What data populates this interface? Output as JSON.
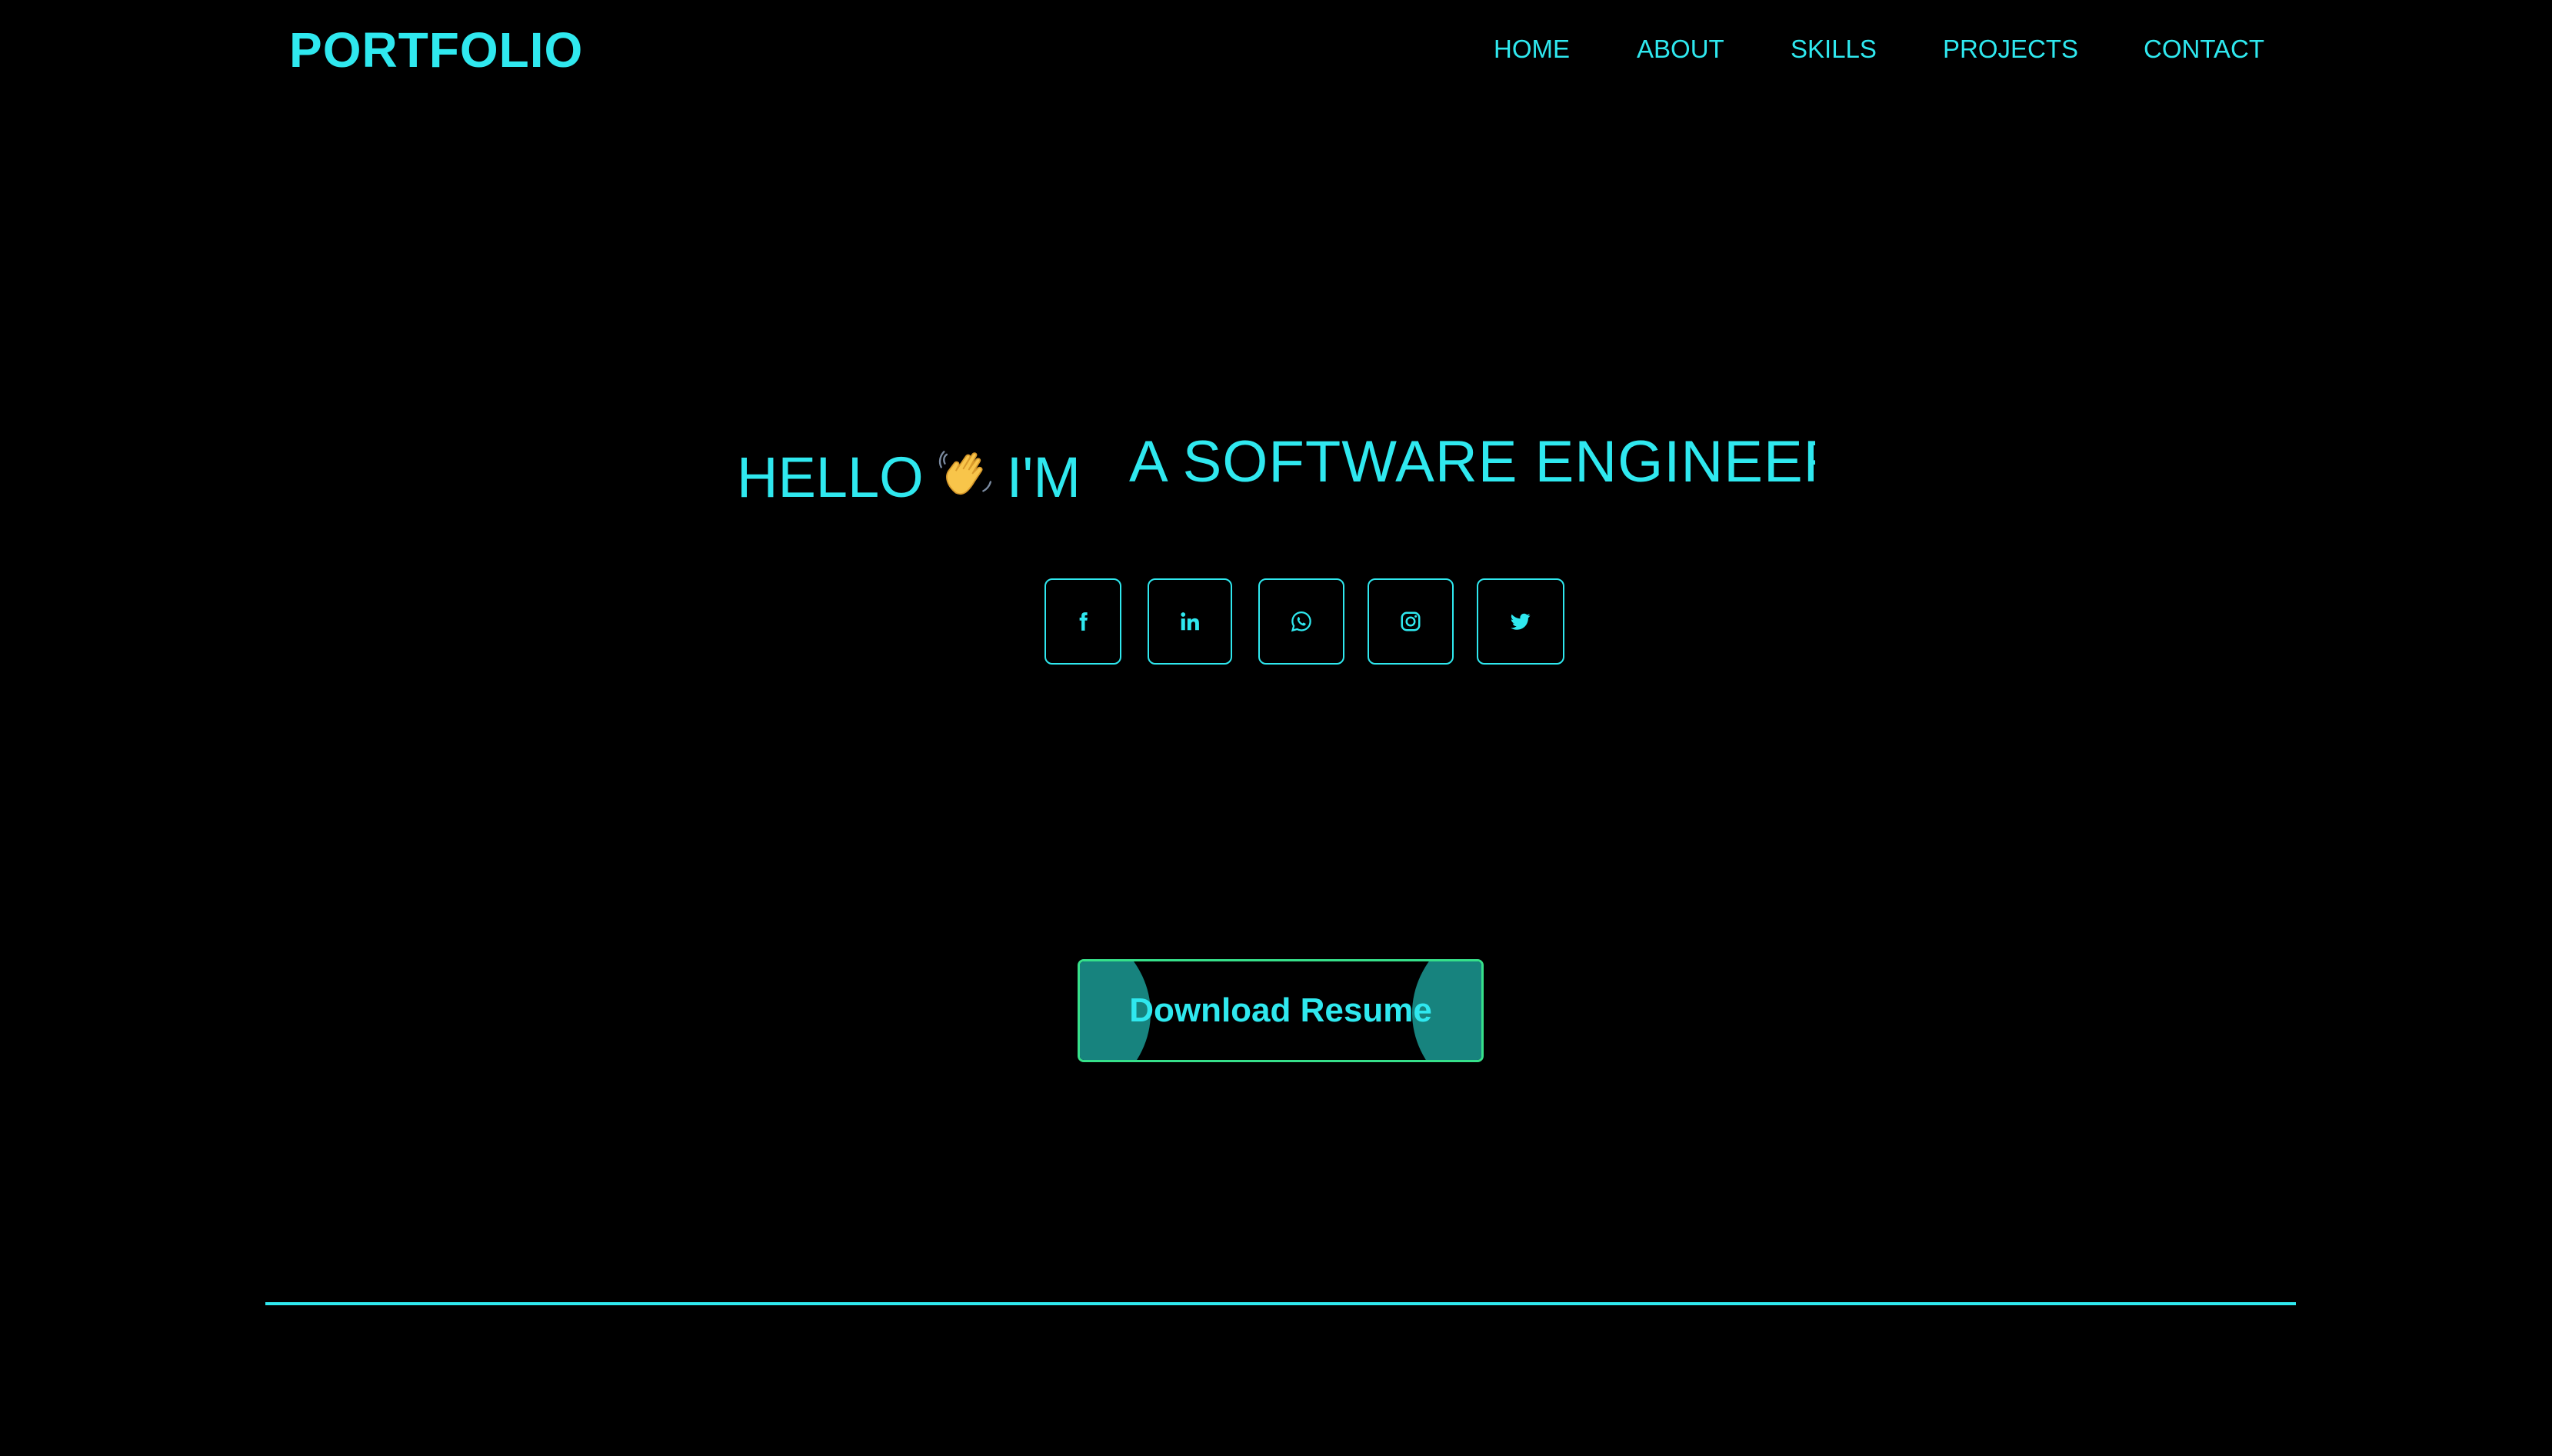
{
  "header": {
    "logo": "PORTFOLIO",
    "nav": {
      "home": "HOME",
      "about": "ABOUT",
      "skills": "SKILLS",
      "projects": "PROJECTS",
      "contact": "CONTACT"
    }
  },
  "hero": {
    "hello": "HELLO",
    "im": "I'M",
    "typed_role": "A SOFTWARE ENGINEER",
    "wave_icon": "waving-hand-emoji"
  },
  "socials": [
    {
      "name": "facebook",
      "icon": "facebook-icon"
    },
    {
      "name": "linkedin",
      "icon": "linkedin-icon"
    },
    {
      "name": "whatsapp",
      "icon": "whatsapp-icon"
    },
    {
      "name": "instagram",
      "icon": "instagram-icon"
    },
    {
      "name": "twitter",
      "icon": "twitter-icon"
    }
  ],
  "resume_button": {
    "label": "Download Resume"
  },
  "colors": {
    "accent": "#2fe8ef",
    "button_border": "#36e08a",
    "button_fill": "#17837e",
    "background": "#000000"
  }
}
